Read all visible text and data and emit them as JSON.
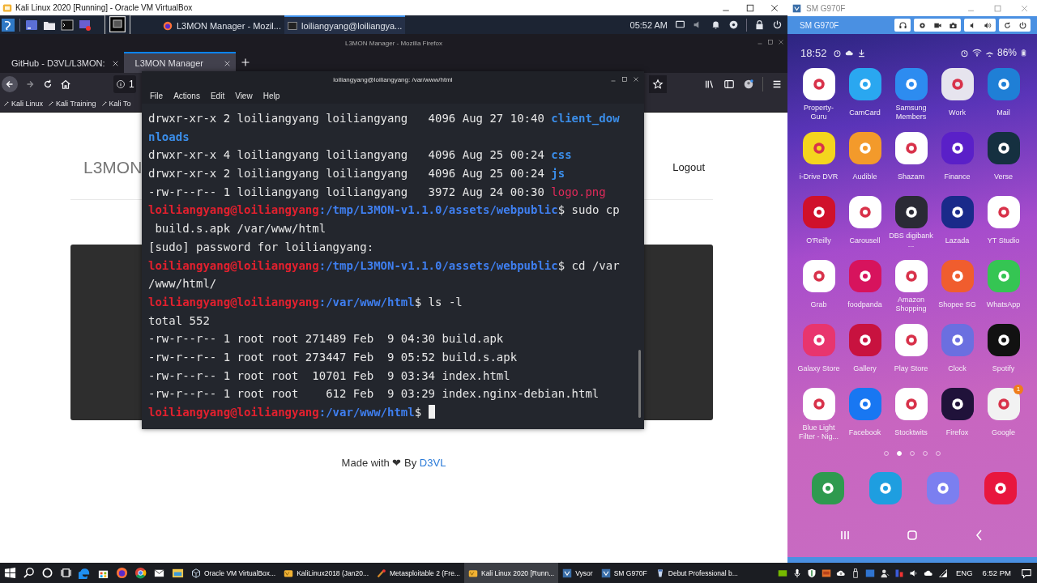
{
  "virtualbox_window": {
    "title": "Kali Linux 2020 [Running] - Oracle VM VirtualBox"
  },
  "kali_panel": {
    "tasks": [
      {
        "kind": "firefox",
        "label": "L3MON Manager - Mozil...",
        "selected": false
      },
      {
        "kind": "terminal",
        "label": "loiliangyang@loiliangya...",
        "selected": true
      }
    ],
    "clock": "05:52 AM"
  },
  "firefox": {
    "title": "L3MON Manager - Mozilla Firefox",
    "tabs": [
      {
        "label": "GitHub - D3VL/L3MON:",
        "selected": false
      },
      {
        "label": "L3MON Manager",
        "selected": true
      }
    ],
    "url": "1",
    "bookmarks": [
      "Kali Linux",
      "Kali Training",
      "Kali To"
    ],
    "page": {
      "logo": "L3MON",
      "logout": "Logout",
      "footer": "Made with ❤ By",
      "footer_link": "D3VL"
    }
  },
  "terminal": {
    "title": "loiliangyang@loiliangyang: /var/www/html",
    "menu": [
      "File",
      "Actions",
      "Edit",
      "View",
      "Help"
    ],
    "lines": [
      [
        {
          "kind": "plain",
          "text": "drwxr-xr-x 2 loiliangyang loiliangyang   4096 Aug 27 10:40 "
        },
        {
          "kind": "dir",
          "text": "client_dow"
        }
      ],
      [
        {
          "kind": "dir",
          "text": "nloads"
        }
      ],
      [
        {
          "kind": "plain",
          "text": "drwxr-xr-x 4 loiliangyang loiliangyang   4096 Aug 25 00:24 "
        },
        {
          "kind": "dir",
          "text": "css"
        }
      ],
      [
        {
          "kind": "plain",
          "text": "drwxr-xr-x 2 loiliangyang loiliangyang   4096 Aug 25 00:24 "
        },
        {
          "kind": "dir",
          "text": "js"
        }
      ],
      [
        {
          "kind": "plain",
          "text": "-rw-r--r-- 1 loiliangyang loiliangyang   3972 Aug 24 00:30 "
        },
        {
          "kind": "image",
          "text": "logo.png"
        }
      ],
      [
        {
          "kind": "user",
          "text": "loiliangyang@loiliangyang"
        },
        {
          "kind": "path",
          "text": ":/tmp/L3MON-v1.1.0/assets/webpublic"
        },
        {
          "kind": "plain",
          "text": "$ sudo cp"
        }
      ],
      [
        {
          "kind": "plain",
          "text": " build.s.apk /var/www/html"
        }
      ],
      [
        {
          "kind": "plain",
          "text": "[sudo] password for loiliangyang:"
        }
      ],
      [
        {
          "kind": "user",
          "text": "loiliangyang@loiliangyang"
        },
        {
          "kind": "path",
          "text": ":/tmp/L3MON-v1.1.0/assets/webpublic"
        },
        {
          "kind": "plain",
          "text": "$ cd /var"
        }
      ],
      [
        {
          "kind": "plain",
          "text": "/www/html/"
        }
      ],
      [
        {
          "kind": "user",
          "text": "loiliangyang@loiliangyang"
        },
        {
          "kind": "path",
          "text": ":/var/www/html"
        },
        {
          "kind": "plain",
          "text": "$ ls -l"
        }
      ],
      [
        {
          "kind": "plain",
          "text": "total 552"
        }
      ],
      [
        {
          "kind": "plain",
          "text": "-rw-r--r-- 1 root root 271489 Feb  9 04:30 build.apk"
        }
      ],
      [
        {
          "kind": "plain",
          "text": "-rw-r--r-- 1 root root 273447 Feb  9 05:52 build.s.apk"
        }
      ],
      [
        {
          "kind": "plain",
          "text": "-rw-r--r-- 1 root root  10701 Feb  9 03:34 index.html"
        }
      ],
      [
        {
          "kind": "plain",
          "text": "-rw-r--r-- 1 root root    612 Feb  9 03:29 index.nginx-debian.html"
        }
      ],
      [
        {
          "kind": "user",
          "text": "loiliangyang@loiliangyang"
        },
        {
          "kind": "path",
          "text": ":/var/www/html"
        },
        {
          "kind": "plain",
          "text": "$ "
        },
        {
          "kind": "cursor"
        }
      ]
    ]
  },
  "vysor": {
    "title": "SM G970F",
    "device": "SM G970F",
    "phone": {
      "time": "18:52",
      "battery": "86%",
      "apps": [
        {
          "label": "Property-Guru",
          "color": "#ffffff"
        },
        {
          "label": "CamCard",
          "color": "#2aa7f0"
        },
        {
          "label": "Samsung Members",
          "color": "#2d8cf0"
        },
        {
          "label": "Work",
          "color": "#e6e4ee"
        },
        {
          "label": "Mail",
          "color": "#1f7fd6"
        },
        {
          "label": "i-Drive DVR",
          "color": "#f4d51e"
        },
        {
          "label": "Audible",
          "color": "#f39a2b"
        },
        {
          "label": "Shazam",
          "color": "#ffffff"
        },
        {
          "label": "Finance",
          "color": "#5a20c8"
        },
        {
          "label": "Verse",
          "color": "#153040"
        },
        {
          "label": "O'Reilly",
          "color": "#d0112b"
        },
        {
          "label": "Carousell",
          "color": "#ffffff"
        },
        {
          "label": "DBS digibank ...",
          "color": "#2a2a35"
        },
        {
          "label": "Lazada",
          "color": "#1a2a8a"
        },
        {
          "label": "YT Studio",
          "color": "#ffffff"
        },
        {
          "label": "Grab",
          "color": "#ffffff"
        },
        {
          "label": "foodpanda",
          "color": "#d7135d"
        },
        {
          "label": "Amazon Shopping",
          "color": "#ffffff"
        },
        {
          "label": "Shopee SG",
          "color": "#f05d2e"
        },
        {
          "label": "WhatsApp",
          "color": "#35c553"
        },
        {
          "label": "Galaxy Store",
          "color": "#e8356e"
        },
        {
          "label": "Gallery",
          "color": "#c8123f"
        },
        {
          "label": "Play Store",
          "color": "#ffffff"
        },
        {
          "label": "Clock",
          "color": "#6b6fe0"
        },
        {
          "label": "Spotify",
          "color": "#111111"
        },
        {
          "label": "Blue Light Filter - Nig...",
          "color": "#ffffff"
        },
        {
          "label": "Facebook",
          "color": "#1877f2"
        },
        {
          "label": "Stocktwits",
          "color": "#ffffff"
        },
        {
          "label": "Firefox",
          "color": "#20123a"
        },
        {
          "label": "Google",
          "color": "#f2f2f2",
          "badge": "1"
        }
      ],
      "page_dots": [
        {
          "selected": false
        },
        {
          "selected": true
        },
        {
          "selected": false
        },
        {
          "selected": false
        },
        {
          "selected": false
        }
      ],
      "dock": [
        {
          "color": "#2e9a4f"
        },
        {
          "color": "#1e9ee0"
        },
        {
          "color": "#7b7ff0"
        },
        {
          "color": "#e8163e"
        }
      ]
    }
  },
  "taskbar": {
    "apps": [
      {
        "label": "Oracle VM VirtualBox...",
        "selected": false
      },
      {
        "label": "KaliLinux2018 (Jan20...",
        "selected": false
      },
      {
        "label": "Metasploitable 2 (Fre...",
        "selected": false
      },
      {
        "label": "Kali Linux 2020 [Runn...",
        "selected": true
      },
      {
        "label": "Vysor",
        "selected": false
      },
      {
        "label": "SM G970F",
        "selected": false
      },
      {
        "label": "Debut Professional b...",
        "selected": false
      }
    ],
    "language": "ENG",
    "clock": "6:52 PM"
  }
}
